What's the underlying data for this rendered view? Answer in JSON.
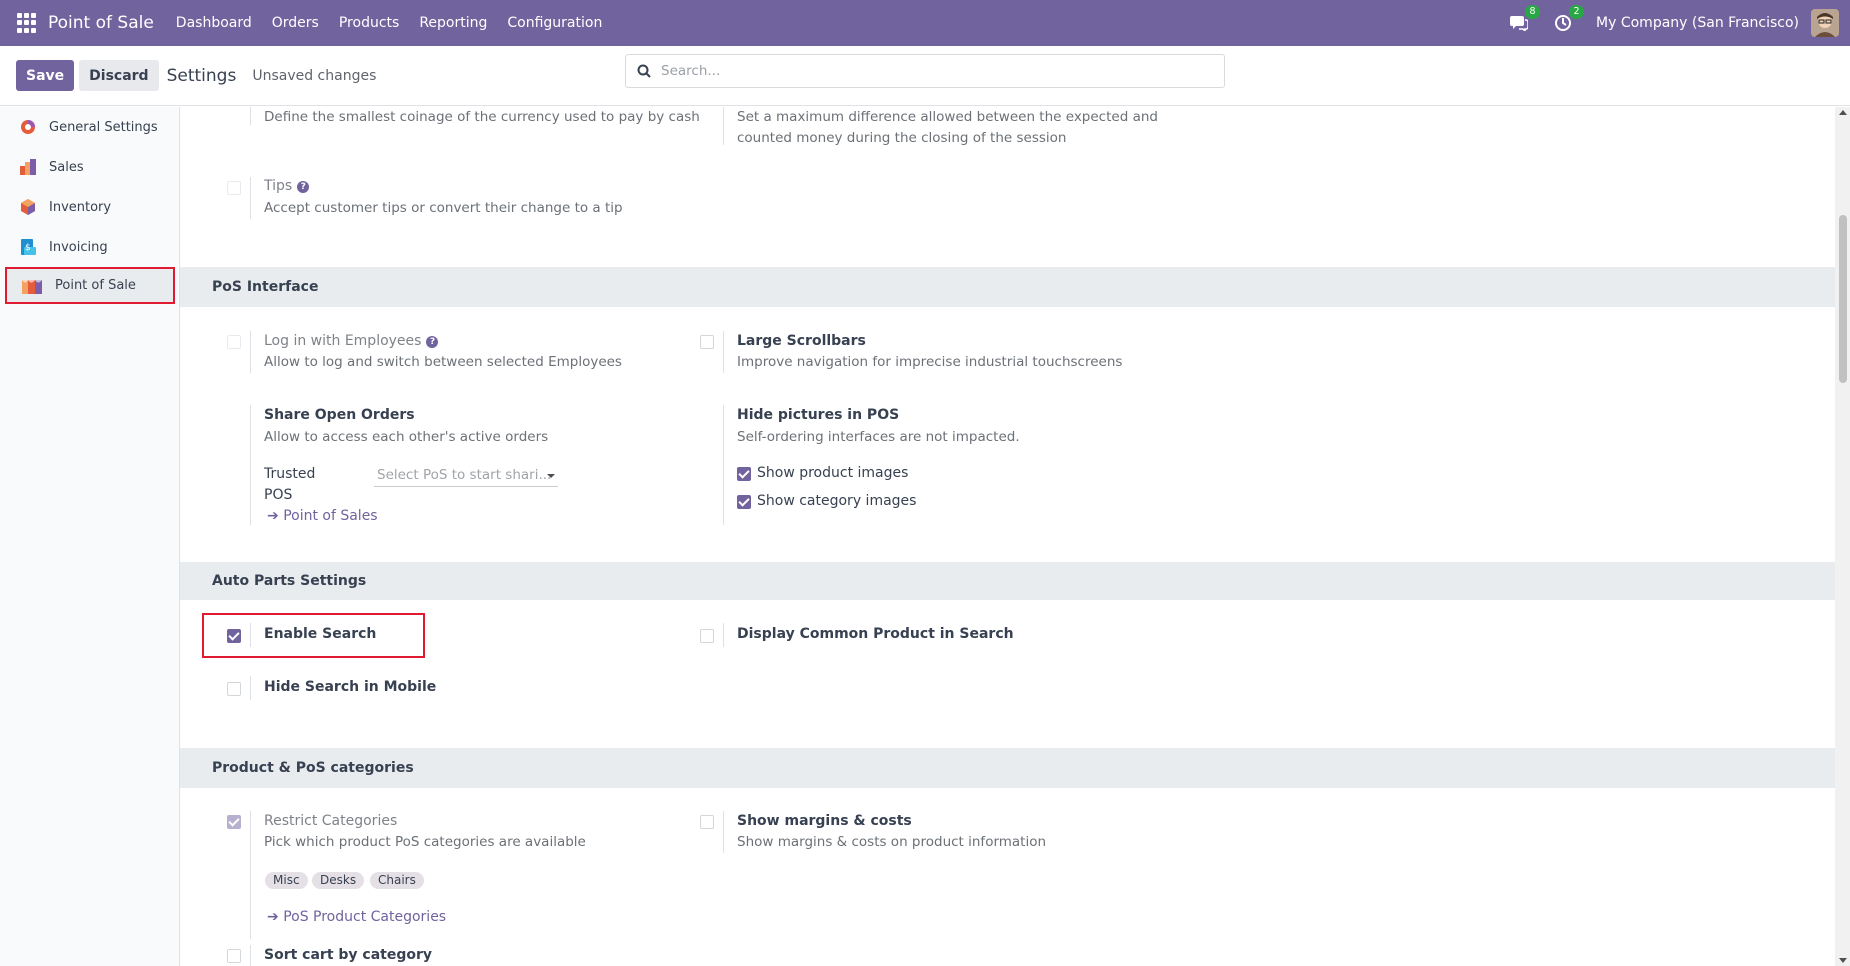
{
  "navbar": {
    "brand": "Point of Sale",
    "menu": [
      "Dashboard",
      "Orders",
      "Products",
      "Reporting",
      "Configuration"
    ],
    "messages_badge": "8",
    "activities_badge": "2",
    "company": "My Company (San Francisco)"
  },
  "control": {
    "save_label": "Save",
    "discard_label": "Discard",
    "title": "Settings",
    "status": "Unsaved changes",
    "search_placeholder": "Search..."
  },
  "sidebar": {
    "items": [
      {
        "label": "General Settings",
        "icon": "odoo-icon"
      },
      {
        "label": "Sales",
        "icon": "sales-icon"
      },
      {
        "label": "Inventory",
        "icon": "inventory-icon"
      },
      {
        "label": "Invoicing",
        "icon": "invoicing-icon"
      },
      {
        "label": "Point of Sale",
        "icon": "pos-icon",
        "active": true
      }
    ]
  },
  "top_partial": {
    "cash_rounding_desc": "Define the smallest coinage of the currency used to pay by cash",
    "cash_control_desc_1": "Set a maximum difference allowed between the expected and",
    "cash_control_desc_2": "counted money during the closing of the session",
    "tips_label": "Tips",
    "tips_desc": "Accept customer tips or convert their change to a tip"
  },
  "pos_interface": {
    "heading": "PoS Interface",
    "login_employees_label": "Log in with Employees",
    "login_employees_desc": "Allow to log and switch between selected Employees",
    "large_scrollbars_label": "Large Scrollbars",
    "large_scrollbars_desc": "Improve navigation for imprecise industrial touchscreens",
    "share_orders_label": "Share Open Orders",
    "share_orders_desc": "Allow to access each other's active orders",
    "trusted_label_1": "Trusted",
    "trusted_label_2": "POS",
    "trusted_placeholder": "Select PoS to start shari...",
    "pos_link": "Point of Sales",
    "hide_pictures_label": "Hide pictures in POS",
    "hide_pictures_desc": "Self-ordering interfaces are not impacted.",
    "show_product_images": "Show product images",
    "show_category_images": "Show category images"
  },
  "auto_parts": {
    "heading": "Auto Parts Settings",
    "enable_search": "Enable Search",
    "display_common": "Display Common Product in Search",
    "hide_mobile": "Hide Search in Mobile"
  },
  "categories": {
    "heading": "Product & PoS categories",
    "restrict_label": "Restrict Categories",
    "restrict_desc": "Pick which product PoS categories are available",
    "tags": [
      "Misc",
      "Desks",
      "Chairs"
    ],
    "categories_link": "PoS Product Categories",
    "margins_label": "Show margins & costs",
    "margins_desc": "Show margins & costs on product information",
    "sort_cart": "Sort cart by category"
  },
  "colors": {
    "brand": "#71639e",
    "highlight": "#e01a30"
  }
}
